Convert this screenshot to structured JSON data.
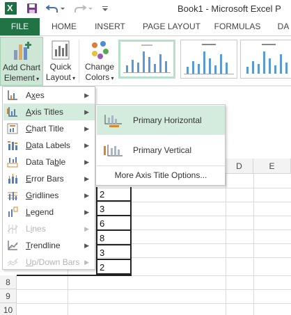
{
  "titlebar": {
    "title": "Book1 - Microsoft Excel P",
    "icons": [
      "excel-logo",
      "save-icon",
      "undo-icon",
      "redo-icon",
      "customize-qat-icon"
    ]
  },
  "tabs": [
    {
      "key": "file",
      "label": "FILE"
    },
    {
      "key": "home",
      "label": "HOME"
    },
    {
      "key": "insert",
      "label": "INSERT"
    },
    {
      "key": "pagelayout",
      "label": "PAGE LAYOUT"
    },
    {
      "key": "formulas",
      "label": "FORMULAS"
    },
    {
      "key": "da",
      "label": "DA"
    }
  ],
  "ribbon": {
    "add_chart_element": {
      "line1": "Add Chart",
      "line2": "Element"
    },
    "quick_layout": {
      "line1": "Quick",
      "line2": "Layout"
    },
    "change_colors": {
      "line1": "Change",
      "line2": "Colors"
    },
    "accent_color": "#217346"
  },
  "menu": {
    "items": [
      {
        "label": "Axes",
        "underline": "x",
        "icon": "axes-icon",
        "disabled": false,
        "active": false
      },
      {
        "label": "Axis Titles",
        "underline": "A",
        "icon": "axis-titles-icon",
        "disabled": false,
        "active": true
      },
      {
        "label": "Chart Title",
        "underline": "C",
        "icon": "chart-title-icon",
        "disabled": false,
        "active": false
      },
      {
        "label": "Data Labels",
        "underline": "D",
        "icon": "data-labels-icon",
        "disabled": false,
        "active": false
      },
      {
        "label": "Data Table",
        "underline": "b",
        "icon": "data-table-icon",
        "disabled": false,
        "active": false
      },
      {
        "label": "Error Bars",
        "underline": "E",
        "icon": "error-bars-icon",
        "disabled": false,
        "active": false
      },
      {
        "label": "Gridlines",
        "underline": "G",
        "icon": "gridlines-icon",
        "disabled": false,
        "active": false
      },
      {
        "label": "Legend",
        "underline": "L",
        "icon": "legend-icon",
        "disabled": false,
        "active": false
      },
      {
        "label": "Lines",
        "underline": "I",
        "icon": "lines-icon",
        "disabled": true,
        "active": false
      },
      {
        "label": "Trendline",
        "underline": "T",
        "icon": "trendline-icon",
        "disabled": false,
        "active": false
      },
      {
        "label": "Up/Down Bars",
        "underline": "U",
        "icon": "updown-bars-icon",
        "disabled": true,
        "active": false
      }
    ]
  },
  "submenu": {
    "primary_horizontal": "Primary Horizontal",
    "primary_vertical": "Primary Vertical",
    "more_options": "More Axis Title Options..."
  },
  "sheet": {
    "visible_columns": [
      "D",
      "E"
    ],
    "visible_rows": [
      "8",
      "9",
      "10"
    ],
    "cell_values": [
      "2",
      "3",
      "6",
      "8",
      "3",
      "2"
    ]
  }
}
